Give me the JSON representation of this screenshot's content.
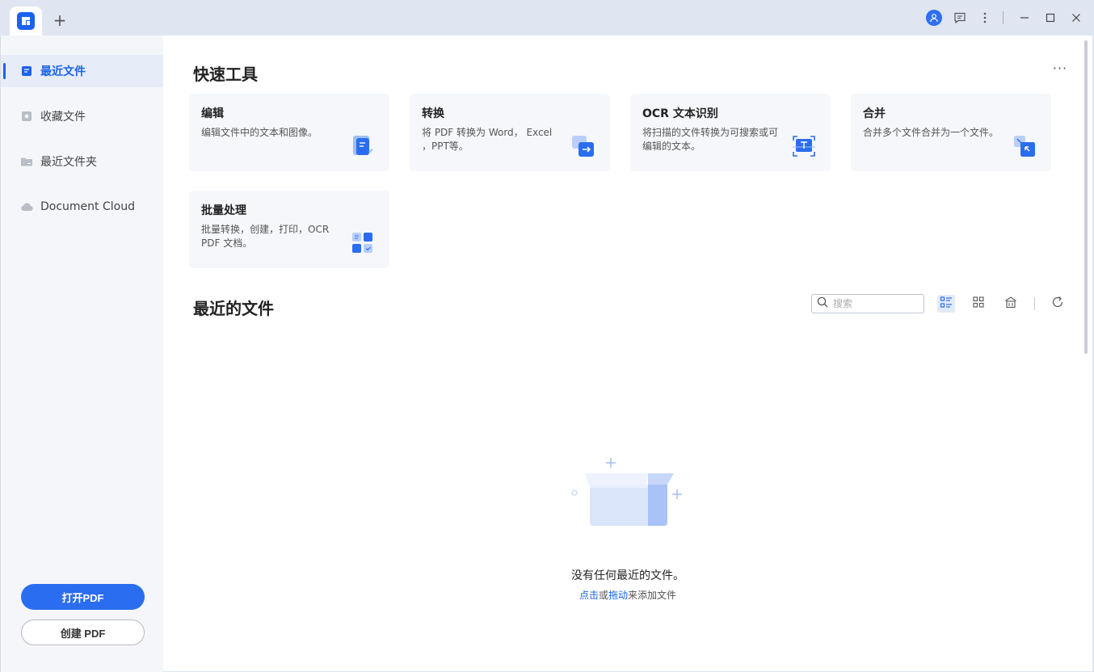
{
  "titlebar": {
    "new_tab": "+"
  },
  "sidebar": {
    "items": [
      {
        "label": "最近文件",
        "icon": "recent-file-icon",
        "active": true
      },
      {
        "label": "收藏文件",
        "icon": "star-file-icon",
        "active": false
      },
      {
        "label": "最近文件夹",
        "icon": "folder-icon",
        "active": false
      },
      {
        "label": "Document Cloud",
        "icon": "cloud-icon",
        "active": false
      }
    ],
    "open_pdf": "打开PDF",
    "create_pdf": "创建 PDF"
  },
  "main": {
    "quick_tools_title": "快速工具",
    "more": "···",
    "cards": [
      {
        "title": "编辑",
        "desc": "编辑文件中的文本和图像。",
        "icon": "edit-doc-icon"
      },
      {
        "title": "转换",
        "desc": "将 PDF 转换为 Word， Excel ，PPT等。",
        "icon": "convert-icon"
      },
      {
        "title": "OCR 文本识别",
        "desc": "将扫描的文件转换为可搜索或可编辑的文本。",
        "icon": "ocr-icon"
      },
      {
        "title": "合并",
        "desc": "合并多个文件合并为一个文件。",
        "icon": "merge-icon"
      },
      {
        "title": "批量处理",
        "desc": "批量转换，创建，打印，OCR PDF 文档。",
        "icon": "batch-icon"
      }
    ],
    "recent_title": "最近的文件",
    "search": {
      "placeholder": "搜索"
    },
    "empty": {
      "message": "没有任何最近的文件。",
      "link_click": "点击",
      "or": "或",
      "link_drag": "拖动",
      "suffix": "来添加文件"
    }
  },
  "colors": {
    "accent": "#1a63f0",
    "sidebar_bg": "#f4f6fa",
    "titlebar_bg": "#dfe6f2"
  }
}
